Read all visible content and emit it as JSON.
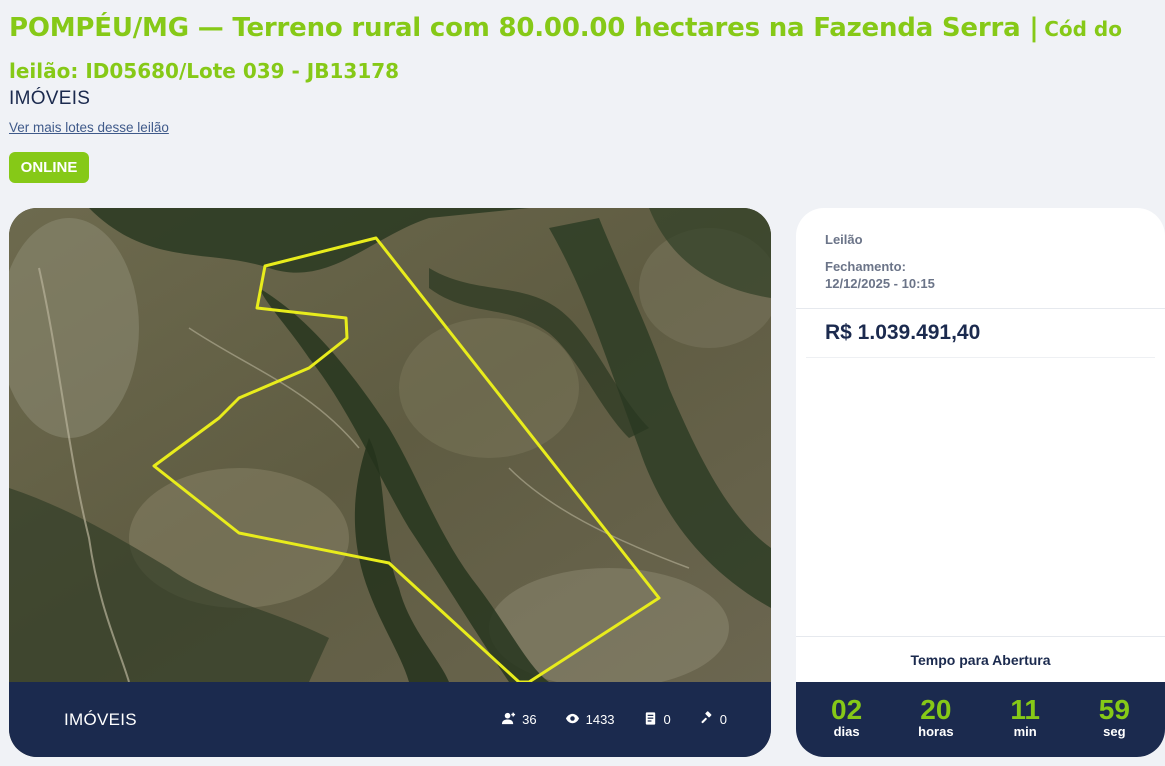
{
  "header": {
    "title_main": "POMPÉU/MG — Terreno rural com 80.00.00 hectares na Fazenda Serra |",
    "title_code": "Cód do leilão: ID05680/Lote 039 - JB13178",
    "category": "IMÓVEIS",
    "more_link": "Ver mais lotes desse leilão",
    "status_badge": "ONLINE"
  },
  "image_card": {
    "category": "IMÓVEIS",
    "stats": {
      "users": "36",
      "views": "1433",
      "docs": "0",
      "bids": "0"
    }
  },
  "info_card": {
    "type_label": "Leilão",
    "closing_label": "Fechamento:",
    "closing_date": "12/12/2025 - 10:15",
    "price": "R$ 1.039.491,40",
    "countdown_title": "Tempo para Abertura",
    "countdown": [
      {
        "value": "02",
        "unit": "dias"
      },
      {
        "value": "20",
        "unit": "horas"
      },
      {
        "value": "11",
        "unit": "min"
      },
      {
        "value": "59",
        "unit": "seg"
      }
    ]
  },
  "colors": {
    "accent_green": "#86c917",
    "navy": "#1b2a4e",
    "boundary_yellow": "#e8ec1c"
  },
  "icons": {
    "users": "user-plus-icon",
    "views": "eye-icon",
    "docs": "document-icon",
    "bids": "gavel-icon"
  }
}
